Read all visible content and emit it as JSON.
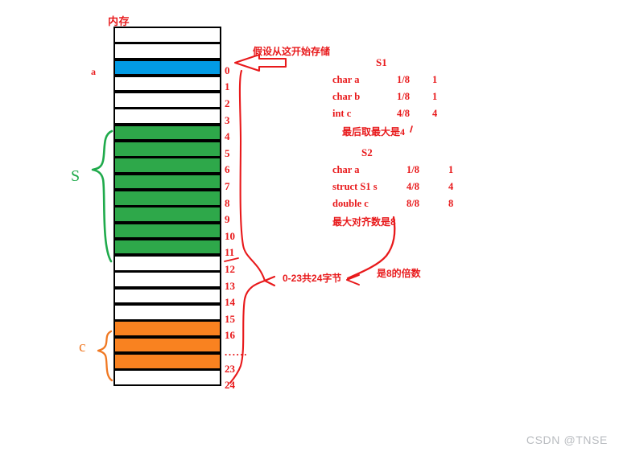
{
  "memory": {
    "title": "内存",
    "cells": [
      {
        "fill": "white",
        "index": ""
      },
      {
        "fill": "white",
        "index": ""
      },
      {
        "fill": "blue",
        "index": "0"
      },
      {
        "fill": "white",
        "index": "1"
      },
      {
        "fill": "white",
        "index": "2"
      },
      {
        "fill": "white",
        "index": "3"
      },
      {
        "fill": "green",
        "index": "4"
      },
      {
        "fill": "green",
        "index": "5"
      },
      {
        "fill": "green",
        "index": "6"
      },
      {
        "fill": "green",
        "index": "7"
      },
      {
        "fill": "green",
        "index": "8"
      },
      {
        "fill": "green",
        "index": "9"
      },
      {
        "fill": "green",
        "index": "10"
      },
      {
        "fill": "green",
        "index": "11"
      },
      {
        "fill": "white",
        "index": "12"
      },
      {
        "fill": "white",
        "index": "13"
      },
      {
        "fill": "white",
        "index": "14"
      },
      {
        "fill": "white",
        "index": "15"
      },
      {
        "fill": "orange",
        "index": "16"
      },
      {
        "fill": "orange",
        "index": "......"
      },
      {
        "fill": "orange",
        "index": "23"
      },
      {
        "fill": "white",
        "index": "24"
      }
    ],
    "colors": {
      "blue": "#029BE5",
      "green": "#2EA84A",
      "orange": "#F98220",
      "border": "#000000"
    }
  },
  "side_labels": {
    "member_a": "a",
    "member_S": "S",
    "member_c": "c"
  },
  "annotations": {
    "start_arrow": "假设从这开始存储",
    "total_bytes": "0-23共24字节",
    "multiple_of_8": "是8的倍数"
  },
  "struct_s1": {
    "title": "S1",
    "rows": [
      {
        "member": "char  a",
        "size": "1/8",
        "align": "1"
      },
      {
        "member": "char  b",
        "size": "1/8",
        "align": "1"
      },
      {
        "member": "int    c",
        "size": "4/8",
        "align": "4"
      }
    ],
    "note": "最后取最大是",
    "note_tail": "4"
  },
  "struct_s2": {
    "title": "S2",
    "rows": [
      {
        "member": "char  a",
        "size": "1/8",
        "align": "1"
      },
      {
        "member": "struct S1 s",
        "size": "4/8",
        "align": "4"
      },
      {
        "member": "double c",
        "size": "8/8",
        "align": "8"
      }
    ],
    "note": "最大对齐数是8",
    "note_tail": ""
  },
  "watermark": {
    "text": "CSDN @TNSE"
  },
  "accent_colors": {
    "red": "#e8191b",
    "green": "#1faa4b",
    "orange": "#F07822",
    "watermark_gray": "#b9bcc0"
  }
}
